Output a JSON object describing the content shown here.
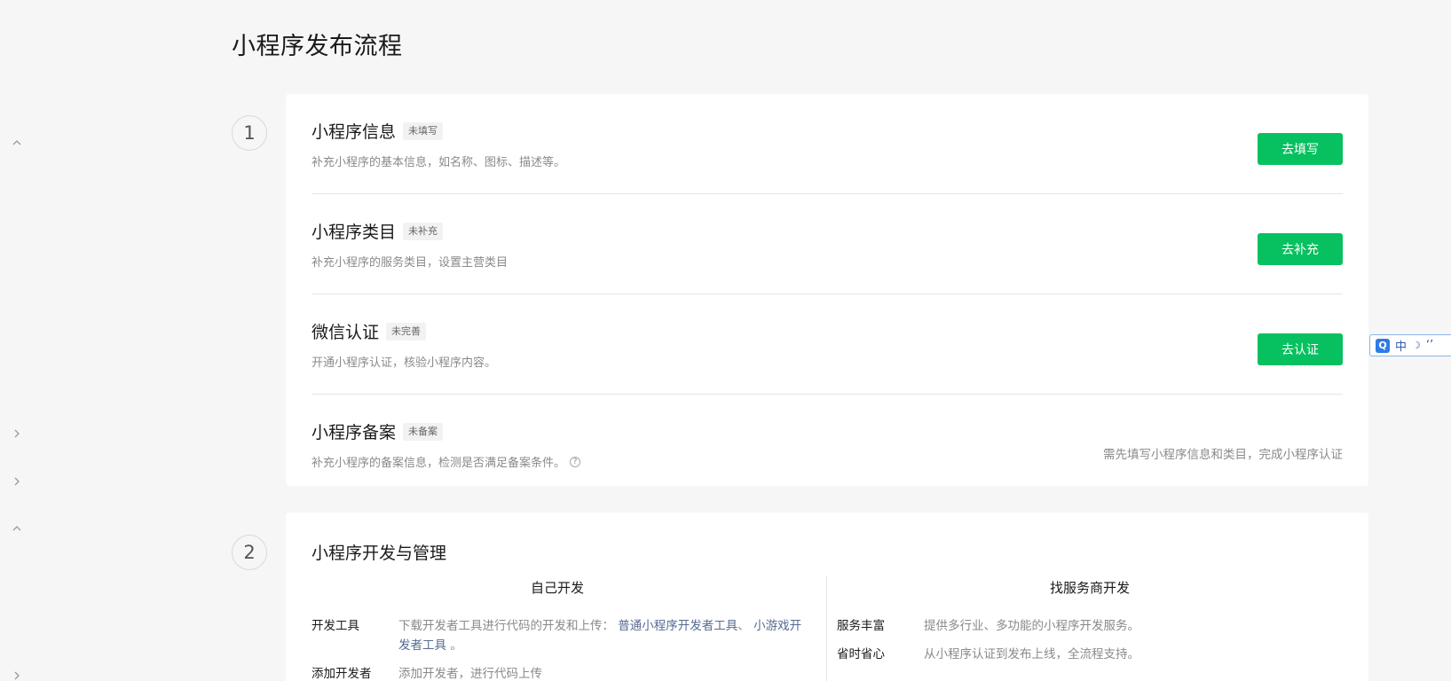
{
  "page": {
    "title": "小程序发布流程"
  },
  "steps": [
    {
      "number": "1"
    },
    {
      "number": "2"
    }
  ],
  "basic_setup": {
    "rows": [
      {
        "title": "小程序信息",
        "badge": "未填写",
        "description": "补充小程序的基本信息，如名称、图标、描述等。",
        "button": "去填写"
      },
      {
        "title": "小程序类目",
        "badge": "未补充",
        "description": "补充小程序的服务类目，设置主营类目",
        "button": "去补充"
      },
      {
        "title": "微信认证",
        "badge": "未完善",
        "description": "开通小程序认证，核验小程序内容。",
        "button": "去认证"
      },
      {
        "title": "小程序备案",
        "badge": "未备案",
        "description": "补充小程序的备案信息，检测是否满足备案条件。",
        "help": "?",
        "note": "需先填写小程序信息和类目，完成小程序认证"
      }
    ]
  },
  "dev": {
    "title": "小程序开发与管理",
    "self": {
      "heading": "自己开发",
      "items": [
        {
          "label": "开发工具",
          "text": "下载开发者工具进行代码的开发和上传：",
          "link1": "普通小程序开发者工具",
          "sep": "、",
          "link2": "小游戏开发者工具",
          "end": "。"
        },
        {
          "label": "添加开发者",
          "text": "添加开发者，进行代码上传"
        }
      ]
    },
    "provider": {
      "heading": "找服务商开发",
      "items": [
        {
          "label": "服务丰富",
          "text": "提供多行业、多功能的小程序开发服务。"
        },
        {
          "label": "省时省心",
          "text": "从小程序认证到发布上线，全流程支持。"
        }
      ]
    }
  },
  "ime": {
    "logo": "Q",
    "mode": "中",
    "moon": "☽",
    "quote": "‘’"
  },
  "colors": {
    "primary_button": "#07c160",
    "link": "#576b95",
    "background": "#f6f6f7"
  }
}
